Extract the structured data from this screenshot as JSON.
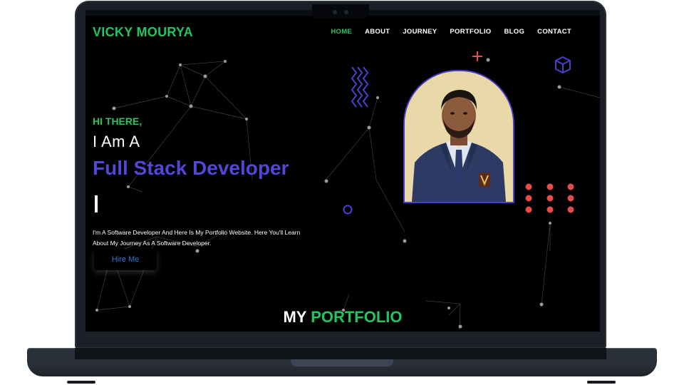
{
  "header": {
    "brand": "VICKY MOURYA",
    "nav": [
      {
        "label": "HOME",
        "active": true
      },
      {
        "label": "ABOUT",
        "active": false
      },
      {
        "label": "JOURNEY",
        "active": false
      },
      {
        "label": "PORTFOLIO",
        "active": false
      },
      {
        "label": "BLOG",
        "active": false
      },
      {
        "label": "CONTACT",
        "active": false
      }
    ]
  },
  "hero": {
    "greeting": "HI THERE,",
    "intro": "I Am A",
    "role": "Full Stack Developer",
    "description_line1": "I'm A Software Developer And Here Is My Portfolio Website. Here You'll Learn",
    "description_line2": "About My Journey As A Software Developer.",
    "cta": "Hire Me"
  },
  "section": {
    "title_part1": "MY ",
    "title_part2": "PORTFOLIO"
  },
  "icons": [
    "zigzag-icon",
    "plus-icon",
    "cube-icon",
    "ring-icon",
    "dot-grid-icon"
  ],
  "colors": {
    "accent_green": "#22c55e",
    "accent_purple": "#5346d8",
    "dot_red": "#e74c4c",
    "background": "#000000",
    "link_blue": "#2e7bd8"
  }
}
